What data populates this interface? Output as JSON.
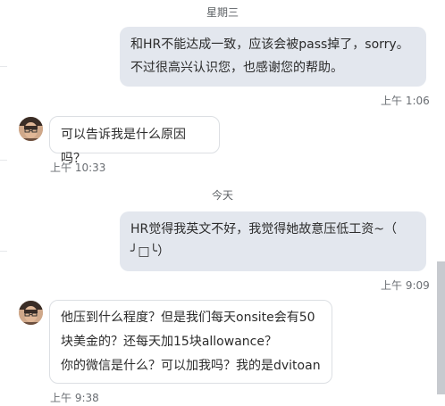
{
  "conversation": {
    "date_1": "星期三",
    "msg_1": {
      "line_1": "和HR不能达成一致，应该会被pass掉了，sorry。",
      "line_2": "不过很高兴认识您，也感谢您的帮助。",
      "time": "上午 1:06"
    },
    "msg_2": {
      "text": "可以告诉我是什么原因吗？",
      "time": "上午 10:33"
    },
    "date_2": "今天",
    "msg_3": {
      "line_1": "HR觉得我英文不好，我觉得她故意压低工资~（",
      "line_2": "╯□╰）",
      "time": "上午 9:09"
    },
    "msg_4": {
      "line_1": "他压到什么程度？但是我们每天onsite会有50",
      "line_2": "块美金的？还每天加15块allowance？",
      "line_3": "你的微信是什么？可以加我吗？我的是dvitoan",
      "time": "上午 9:38"
    }
  },
  "colors": {
    "outgoing_bubble": "#e3e7ee",
    "incoming_border": "#dcdfe3",
    "scroll_thumb": "#c7cacf"
  },
  "icons": [
    "contact-avatar"
  ]
}
